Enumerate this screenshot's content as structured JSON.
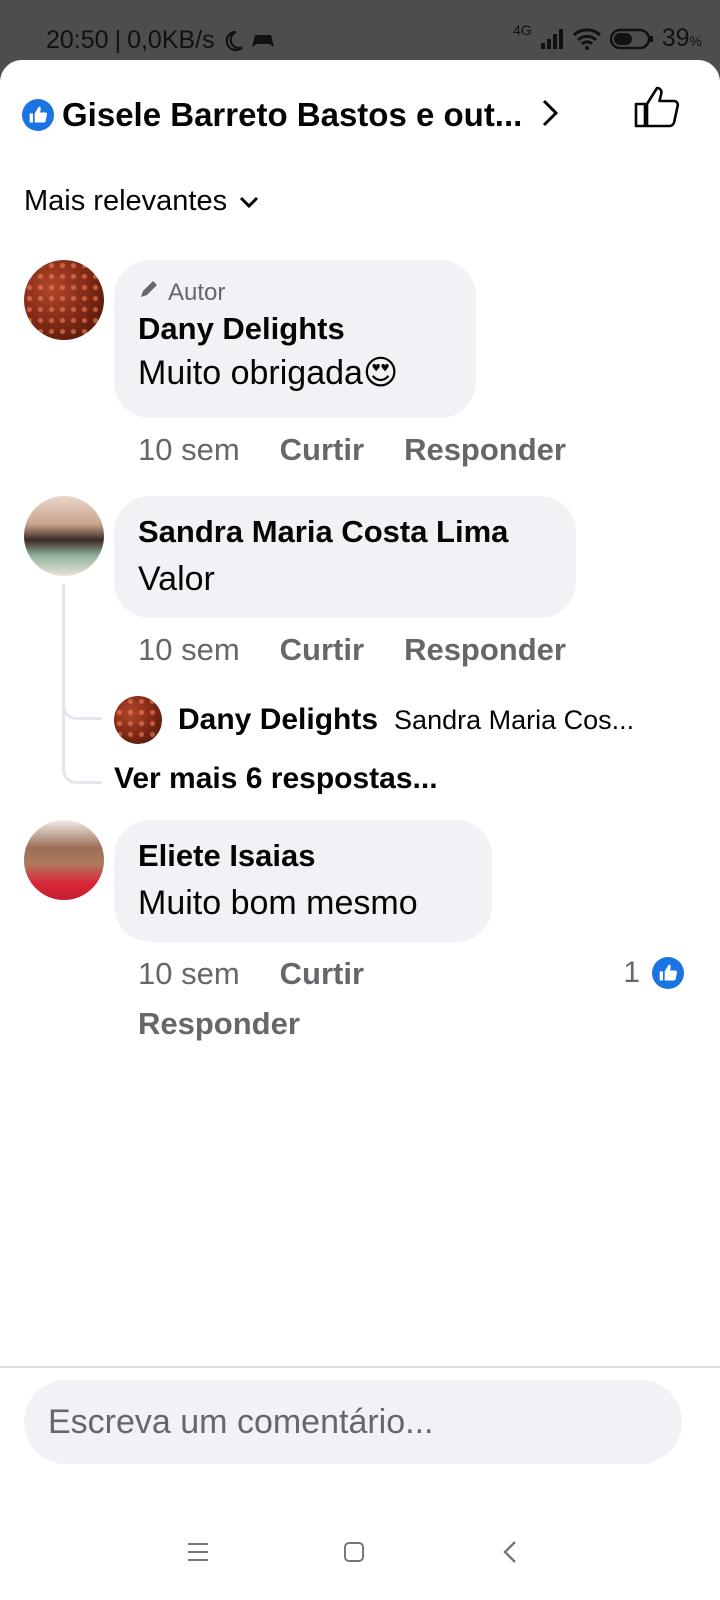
{
  "status_bar": {
    "time": "20:50",
    "speed": "0,0KB/s",
    "network": "4G",
    "battery": "39",
    "battery_unit": "%"
  },
  "header": {
    "reactors": "Gisele Barreto Bastos e out...",
    "icons": [
      "like-badge-icon",
      "chevron-right-icon",
      "thumbs-up-outline-icon"
    ]
  },
  "sort": {
    "label": "Mais relevantes"
  },
  "comments": [
    {
      "badge": "Autor",
      "name": "Dany Delights",
      "text": "Muito obrigada",
      "emoji": "😍",
      "time": "10 sem",
      "like": "Curtir",
      "reply": "Responder"
    },
    {
      "name": "Sandra Maria Costa Lima",
      "text": "Valor",
      "time": "10 sem",
      "like": "Curtir",
      "reply": "Responder",
      "reply_preview": {
        "name": "Dany Delights",
        "text": "Sandra Maria Cos..."
      },
      "more_replies": "Ver mais 6 respostas..."
    },
    {
      "name": "Eliete Isaias",
      "text": "Muito bom mesmo",
      "time": "10 sem",
      "like": "Curtir",
      "reply": "Responder",
      "likes": "1"
    }
  ],
  "composer": {
    "placeholder": "Escreva um comentário..."
  },
  "colors": {
    "accent": "#1b74e4",
    "bubble": "#f0f2f5",
    "secondary_text": "#65676b"
  }
}
